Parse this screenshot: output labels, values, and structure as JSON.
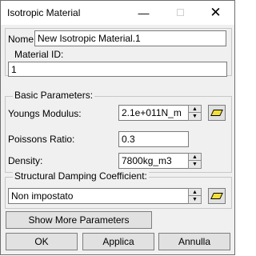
{
  "window": {
    "title": "Isotropic Material",
    "minimize": "—",
    "maximize": "☐",
    "close": "✕"
  },
  "nome": {
    "label": "Nome",
    "value": "New Isotropic Material.1"
  },
  "material_id": {
    "title": "Material ID:",
    "value": "1"
  },
  "basic": {
    "title": "Basic Parameters:",
    "youngs_label": "Youngs Modulus:",
    "youngs_value": "2.1e+011N_m",
    "poisson_label": "Poissons Ratio:",
    "poisson_value": "0.3",
    "density_label": "Density:",
    "density_value": "7800kg_m3"
  },
  "damping": {
    "title": "Structural Damping Coefficient:",
    "value": "Non impostato"
  },
  "buttons": {
    "show_more": "Show More Parameters",
    "ok": "OK",
    "apply": "Applica",
    "cancel": "Annulla"
  },
  "icons": {
    "spin_up": "▲",
    "spin_down": "▼"
  }
}
